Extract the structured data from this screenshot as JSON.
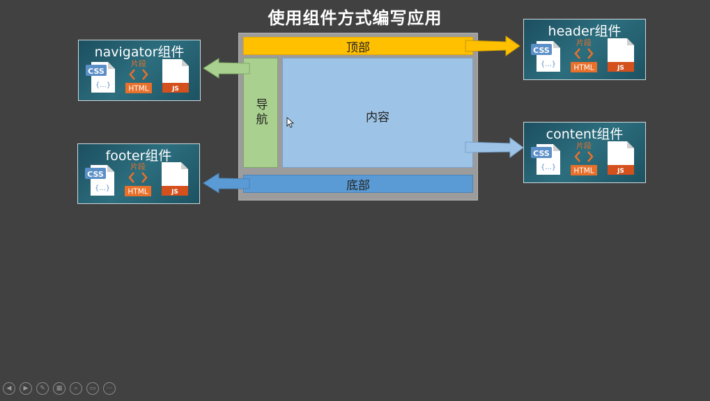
{
  "title": "使用组件方式编写应用",
  "layout": {
    "header": "顶部",
    "nav": "导航",
    "content": "内容",
    "footer": "底部"
  },
  "colors": {
    "header": "#ffc000",
    "nav": "#a9d08e",
    "content": "#9dc3e6",
    "footer": "#5b9bd5"
  },
  "components": {
    "header": "header组件",
    "navigator": "navigator组件",
    "content": "content组件",
    "footer": "footer组件"
  },
  "icon_labels": {
    "css": "CSS",
    "css_braces": "{...}",
    "fragment": "片段",
    "html": "HTML",
    "js": "JS"
  },
  "toolbar": {
    "icons": [
      "prev-icon",
      "next-icon",
      "pen-icon",
      "slides-icon",
      "zoom-icon",
      "subtitle-icon",
      "more-icon"
    ]
  }
}
